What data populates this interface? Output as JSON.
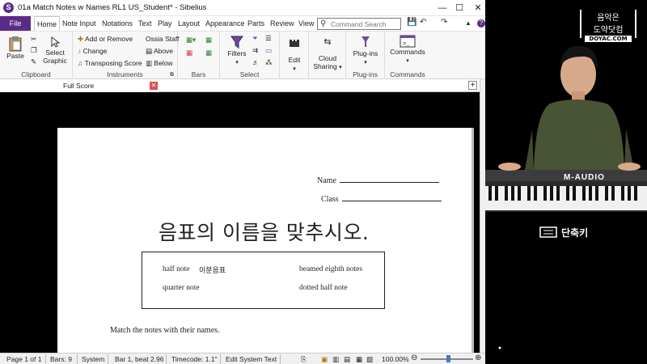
{
  "window": {
    "title": "01a Match Notes w Names RL1 US_Student* - Sibelius",
    "logo_letter": "S",
    "minimize": "—",
    "maximize": "☐",
    "close": "✕"
  },
  "tabs": {
    "file": "File",
    "items": [
      "Home",
      "Note Input",
      "Notations",
      "Text",
      "Play",
      "Layout",
      "Appearance",
      "Parts",
      "Review",
      "View"
    ]
  },
  "search": {
    "placeholder": "Command Search"
  },
  "ribbon": {
    "clipboard": {
      "label": "Clipboard",
      "paste": "Paste",
      "select_graphic_1": "Select",
      "select_graphic_2": "Graphic"
    },
    "instruments": {
      "label": "Instruments",
      "add_remove": "Add or Remove",
      "change": "Change",
      "transposing": "Transposing Score",
      "ossia": "Ossia Staff",
      "above": "Above",
      "below": "Below"
    },
    "bars": {
      "label": "Bars"
    },
    "select": {
      "label": "Select",
      "filters": "Filters"
    },
    "edit": {
      "label": "Edit"
    },
    "cloud": {
      "label_1": "Cloud",
      "label_2": "Sharing"
    },
    "plugins": {
      "label": "Plug-ins",
      "button": "Plug-ins"
    },
    "commands": {
      "label": "Commands",
      "button": "Commands"
    }
  },
  "doc_tab": {
    "label": "Full Score"
  },
  "score": {
    "name_label": "Name",
    "class_label": "Class",
    "heading": "음표의 이름을 맞추시오.",
    "words": {
      "half_note": "half note",
      "half_note_kr": "이분음표",
      "beamed": "beamed eighth notes",
      "quarter": "quarter note",
      "dotted_half": "dotted half note"
    },
    "instruction": "Match the notes with their names."
  },
  "status": {
    "page": "Page 1 of 1",
    "bars": "Bars: 9",
    "system": "System",
    "position": "Bar 1, beat 2.96",
    "timecode": "Timecode: 1.1\"",
    "mode": "Edit System Text",
    "zoom": "100.00%"
  },
  "video": {
    "brand_1": "음악은",
    "brand_2": "도약닷컴",
    "brand_3": "DOYAC.COM",
    "keyboard_brand": "M-AUDIO",
    "shortcut": "단축키"
  },
  "colors": {
    "accent": "#5b2a86",
    "close_red": "#d9534f"
  }
}
